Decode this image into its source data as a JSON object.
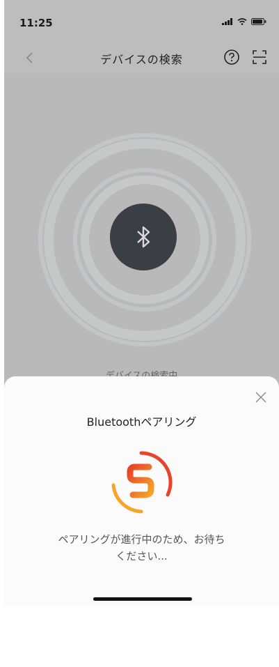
{
  "status_bar": {
    "time": "11:25"
  },
  "nav": {
    "title": "デバイスの検索"
  },
  "scan": {
    "searching_text": "デバイスの検索中"
  },
  "sheet": {
    "title": "Bluetoothペアリング",
    "message_line1": "ペアリングが進行中のため、お待ち",
    "message_line2": "ください..."
  },
  "colors": {
    "accent_red": "#e8432b",
    "accent_orange": "#f4a52a",
    "overlay": "#b9b9b9",
    "bt_circle": "#3b3e44"
  },
  "icons": [
    "back-chevron-icon",
    "help-icon",
    "scan-icon",
    "bluetooth-icon",
    "close-icon",
    "loading-spinner-icon"
  ]
}
